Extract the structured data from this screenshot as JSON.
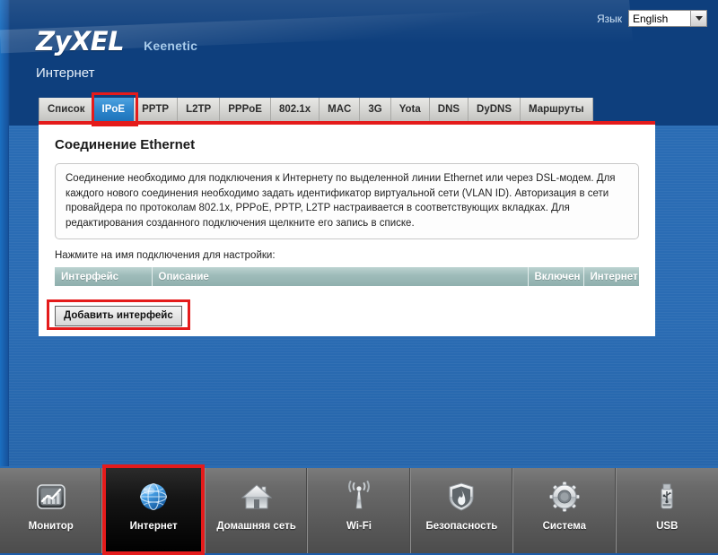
{
  "header": {
    "brand_logo": "ZyXEL",
    "brand_model": "Keenetic",
    "page_title": "Интернет",
    "language": {
      "label": "Язык",
      "selected": "English",
      "arrow_icon": "chevron-down-icon"
    }
  },
  "tabs": [
    {
      "label": "Список",
      "active": false
    },
    {
      "label": "IPoE",
      "active": true
    },
    {
      "label": "PPTP",
      "active": false
    },
    {
      "label": "L2TP",
      "active": false
    },
    {
      "label": "PPPoE",
      "active": false
    },
    {
      "label": "802.1x",
      "active": false
    },
    {
      "label": "MAC",
      "active": false
    },
    {
      "label": "3G",
      "active": false
    },
    {
      "label": "Yota",
      "active": false
    },
    {
      "label": "DNS",
      "active": false
    },
    {
      "label": "DyDNS",
      "active": false
    },
    {
      "label": "Маршруты",
      "active": false
    }
  ],
  "content": {
    "section_title": "Соединение Ethernet",
    "info_text": "Соединение необходимо для подключения к Интернету по выделенной линии Ethernet или через DSL-модем. Для каждого нового соединения необходимо задать идентификатор виртуальной сети (VLAN ID). Авторизация в сети провайдера по протоколам 802.1x, PPPoE, PPTP, L2TP настраивается в соответствующих вкладках. Для редактирования созданного подключения щелкните его запись в списке.",
    "hint": "Нажмите на имя подключения для настройки:",
    "table": {
      "columns": [
        "Интерфейс",
        "Описание",
        "Включен",
        "Интернет"
      ],
      "rows": []
    },
    "add_button": "Добавить интерфейс"
  },
  "bottom_nav": [
    {
      "label": "Монитор",
      "icon": "chart-monitor-icon",
      "active": false
    },
    {
      "label": "Интернет",
      "icon": "globe-icon",
      "active": true
    },
    {
      "label": "Домашняя сеть",
      "icon": "house-icon",
      "active": false
    },
    {
      "label": "Wi-Fi",
      "icon": "wifi-antenna-icon",
      "active": false
    },
    {
      "label": "Безопасность",
      "icon": "shield-flame-icon",
      "active": false
    },
    {
      "label": "Система",
      "icon": "gear-icon",
      "active": false
    },
    {
      "label": "USB",
      "icon": "usb-drive-icon",
      "active": false
    }
  ],
  "annotations": {
    "accent_color": "#e41b1b"
  }
}
